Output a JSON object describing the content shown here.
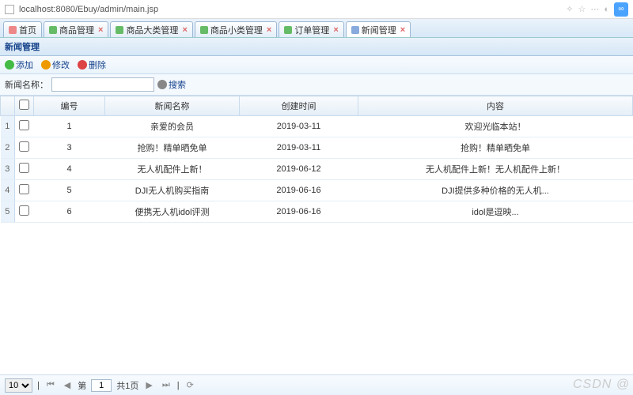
{
  "addressbar": {
    "url": "localhost:8080/Ebuy/admin/main.jsp"
  },
  "tabs": [
    {
      "label": "首页",
      "kind": "home"
    },
    {
      "label": "商品管理",
      "kind": "green"
    },
    {
      "label": "商品大类管理",
      "kind": "green"
    },
    {
      "label": "商品小类管理",
      "kind": "green"
    },
    {
      "label": "订单管理",
      "kind": "green"
    },
    {
      "label": "新闻管理",
      "kind": "news",
      "active": true
    }
  ],
  "panel": {
    "title": "新闻管理"
  },
  "toolbar": {
    "add": "添加",
    "edit": "修改",
    "del": "删除"
  },
  "search": {
    "label": "新闻名称：",
    "btn": "搜索"
  },
  "columns": {
    "id": "编号",
    "name": "新闻名称",
    "time": "创建时间",
    "content": "内容"
  },
  "rows": [
    {
      "n": "1",
      "id": "1",
      "name": "亲爱的会员",
      "time": "2019-03-11",
      "content": "欢迎光临本站！"
    },
    {
      "n": "2",
      "id": "3",
      "name": "抢购！精单晒免单",
      "time": "2019-03-11",
      "content": "抢购！精单晒免单"
    },
    {
      "n": "3",
      "id": "4",
      "name": "无人机配件上新！",
      "time": "2019-06-12",
      "content": "无人机配件上新！无人机配件上新！"
    },
    {
      "n": "4",
      "id": "5",
      "name": "DJI无人机购买指南",
      "time": "2019-06-16",
      "content": "DJI提供多种价格的无人机..."
    },
    {
      "n": "5",
      "id": "6",
      "name": "便携无人机idol评测",
      "time": "2019-06-16",
      "content": "idol是逗映..."
    }
  ],
  "pager": {
    "pagesize": "10",
    "page": "1",
    "total_label_a": "第",
    "total_label_b": "共1页",
    "sep": "|"
  },
  "watermark": "CSDN @"
}
